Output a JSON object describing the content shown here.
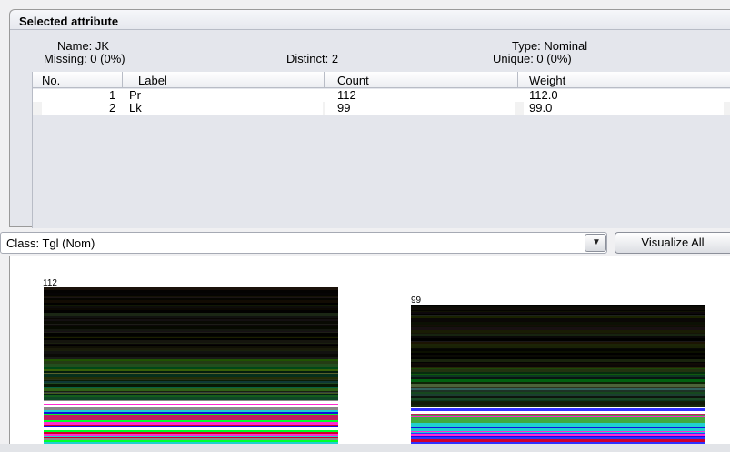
{
  "attribute_panel": {
    "title": "Selected attribute",
    "name_label": "Name: JK",
    "missing_label": "Missing: 0 (0%)",
    "distinct_label": "Distinct: 2",
    "type_label": "Type: Nominal",
    "unique_label": "Unique: 0 (0%)"
  },
  "table": {
    "headers": [
      "No.",
      "Label",
      "Count",
      "Weight"
    ],
    "rows": [
      {
        "no": "1",
        "label": "Pr",
        "count": "112",
        "weight": "112.0"
      },
      {
        "no": "2",
        "label": "Lk",
        "count": "99",
        "weight": "99.0"
      }
    ]
  },
  "class_selector": {
    "value": "Class: Tgl (Nom)",
    "dropdown_icon": "chevron-down-icon"
  },
  "visualize_all_label": "Visualize All",
  "histogram": {
    "bars": [
      {
        "label": "112",
        "value": 112
      },
      {
        "label": "99",
        "value": 99
      }
    ],
    "colors": {
      "dark": "#050505",
      "green": "#00ff2a",
      "red": "#d0002a",
      "magenta": "#ff2bd0",
      "blue": "#1010e0",
      "cyan": "#20d0d0"
    }
  }
}
